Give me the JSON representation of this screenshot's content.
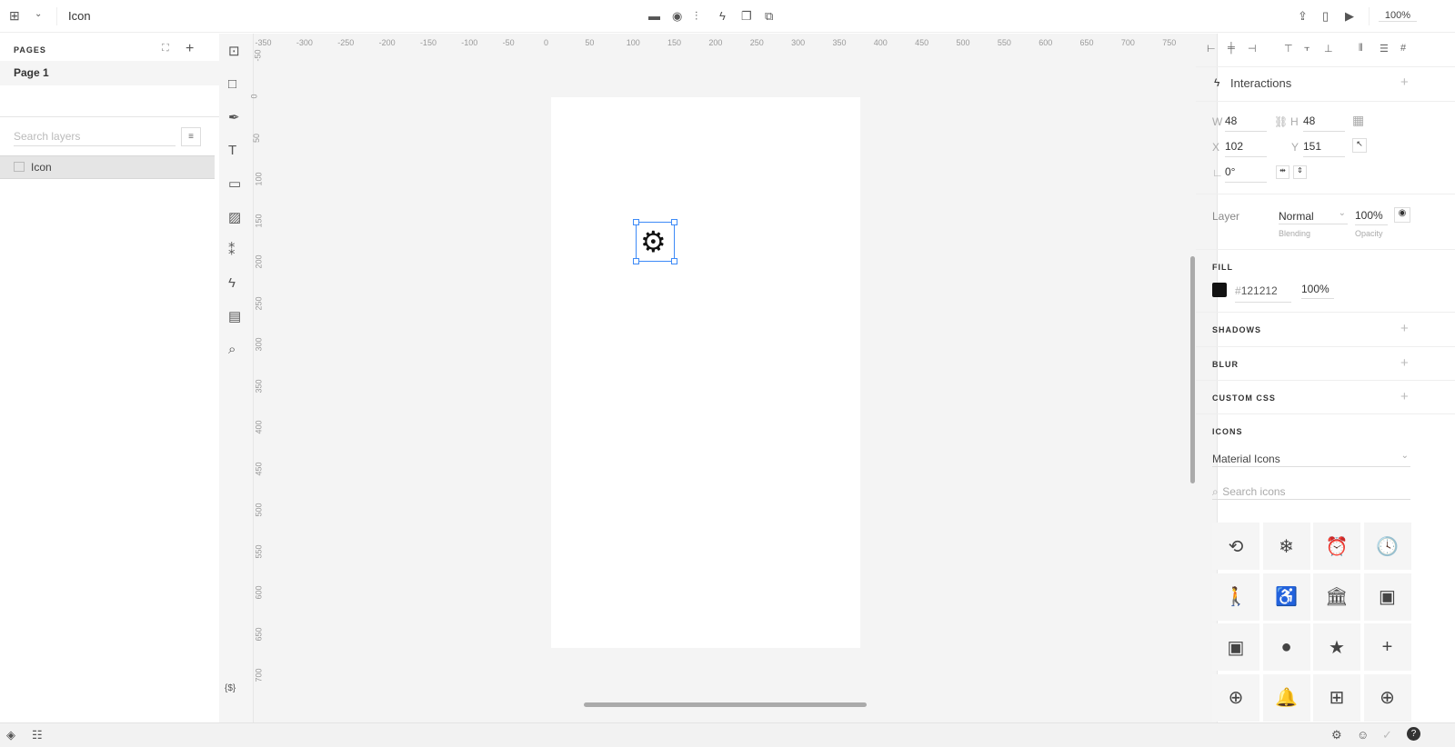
{
  "topbar": {
    "title": "Icon",
    "zoom": "100%",
    "center_icons": [
      "folder-icon",
      "component-icon",
      "distribute-icon",
      "lightning-icon",
      "bring-front-icon",
      "group-icon"
    ],
    "right_icons": [
      "export-icon",
      "device-icon",
      "play-icon"
    ]
  },
  "pages": {
    "label": "PAGES",
    "items": [
      {
        "label": "Page 1"
      }
    ]
  },
  "layers": {
    "search_placeholder": "Search layers",
    "items": [
      {
        "label": "Icon",
        "icon": "image-icon"
      }
    ]
  },
  "tools": [
    "text-box-icon",
    "rectangle-icon",
    "pen-icon",
    "text-icon",
    "input-icon",
    "image-icon",
    "component-icon",
    "lightning-icon",
    "comment-icon",
    "search-icon",
    "variables-icon"
  ],
  "tools_variables_label": "{$}",
  "ruler": {
    "h": [
      "-350",
      "-300",
      "-250",
      "-200",
      "-150",
      "-100",
      "-50",
      "0",
      "50",
      "100",
      "150",
      "200",
      "250",
      "300",
      "350",
      "400",
      "450",
      "500",
      "550",
      "600",
      "650",
      "700",
      "750"
    ],
    "v": [
      "-50",
      "0",
      "50",
      "100",
      "150",
      "200",
      "250",
      "300",
      "350",
      "400",
      "450",
      "500",
      "550",
      "600",
      "650",
      "700"
    ]
  },
  "selection": {
    "icon": "settings-icon",
    "color": "#121212"
  },
  "inspector": {
    "interactions": "Interactions",
    "w_label": "W",
    "w": "48",
    "h_label": "H",
    "h": "48",
    "x_label": "X",
    "x": "102",
    "y_label": "Y",
    "y": "151",
    "rotation": "0°",
    "layer_label": "Layer",
    "blending": "Normal",
    "blending_label": "Blending",
    "opacity": "100%",
    "opacity_label": "Opacity",
    "fill_label": "FILL",
    "fill_hash": "#",
    "fill_hex": "121212",
    "fill_opacity": "100%",
    "fill_color": "#121212",
    "shadows": "SHADOWS",
    "blur": "BLUR",
    "custom_css": "CUSTOM CSS",
    "icons_label": "ICONS",
    "icon_set": "Material Icons",
    "icon_search_placeholder": "Search icons",
    "icon_grid": [
      {
        "name": "3d-rotation-icon",
        "glyph": "⟲"
      },
      {
        "name": "ac-unit-icon",
        "glyph": "❄"
      },
      {
        "name": "access-alarm-icon",
        "glyph": "⏰"
      },
      {
        "name": "access-time-icon",
        "glyph": "🕓"
      },
      {
        "name": "accessibility-icon",
        "glyph": "🚶"
      },
      {
        "name": "accessible-icon",
        "glyph": "♿"
      },
      {
        "name": "account-balance-icon",
        "glyph": "🏛"
      },
      {
        "name": "account-balance-wallet-icon",
        "glyph": "▣"
      },
      {
        "name": "account-box-icon",
        "glyph": "▣"
      },
      {
        "name": "account-circle-icon",
        "glyph": "●"
      },
      {
        "name": "local-activity-icon",
        "glyph": "★"
      },
      {
        "name": "add-icon",
        "glyph": "+"
      },
      {
        "name": "add-alarm-icon",
        "glyph": "⊕"
      },
      {
        "name": "add-alert-icon",
        "glyph": "🔔"
      },
      {
        "name": "add-box-icon",
        "glyph": "⊞"
      },
      {
        "name": "add-circle-icon",
        "glyph": "⊕"
      }
    ]
  },
  "bottombar": {
    "left_icons": [
      "layers-icon",
      "assets-icon"
    ],
    "right_icons": [
      "settings-panel-icon",
      "accessibility-icon",
      "check-icon",
      "help-icon"
    ]
  }
}
